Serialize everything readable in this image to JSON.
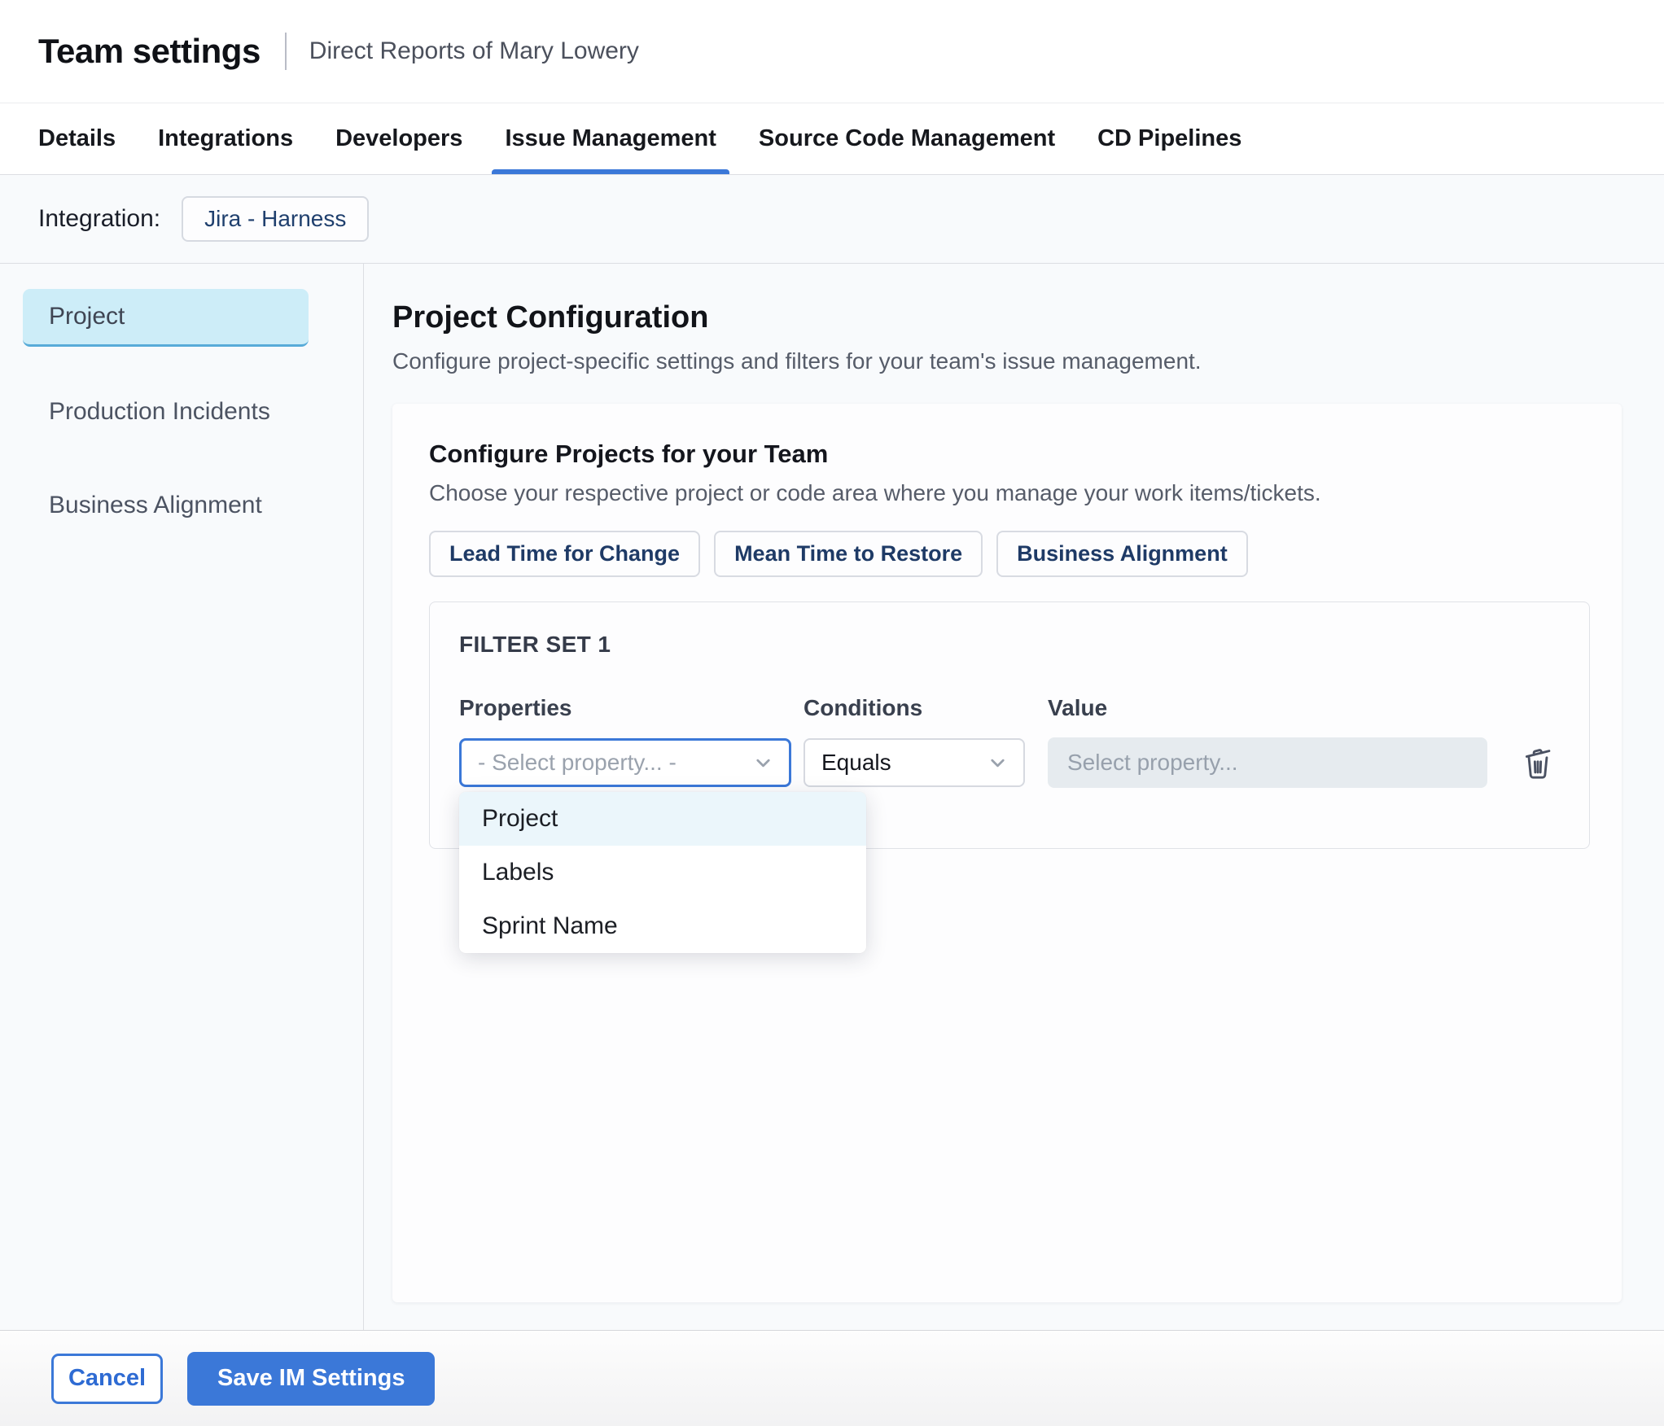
{
  "page": {
    "title": "Team settings",
    "subtitle": "Direct Reports of Mary Lowery"
  },
  "tabs": [
    {
      "label": "Details",
      "active": false
    },
    {
      "label": "Integrations",
      "active": false
    },
    {
      "label": "Developers",
      "active": false
    },
    {
      "label": "Issue Management",
      "active": true
    },
    {
      "label": "Source Code Management",
      "active": false
    },
    {
      "label": "CD Pipelines",
      "active": false
    }
  ],
  "integration": {
    "label": "Integration:",
    "chip": "Jira - Harness"
  },
  "sidebar": {
    "items": [
      {
        "label": "Project",
        "selected": true
      },
      {
        "label": "Production Incidents",
        "selected": false
      },
      {
        "label": "Business Alignment",
        "selected": false
      }
    ]
  },
  "main": {
    "heading": "Project Configuration",
    "description": "Configure project-specific settings and filters for your team's issue management.",
    "card": {
      "title": "Configure Projects for your Team",
      "subtitle": "Choose your respective project or code area where you manage your work items/tickets.",
      "chips": [
        "Lead Time for Change",
        "Mean Time to Restore",
        "Business Alignment"
      ],
      "filter_set": {
        "title": "FILTER SET 1",
        "columns": [
          "Properties",
          "Conditions",
          "Value"
        ],
        "property_select": {
          "placeholder": "- Select property... -"
        },
        "condition_select": {
          "value": "Equals"
        },
        "value_input": {
          "placeholder": "Select property..."
        },
        "dropdown_options": [
          {
            "label": "Project",
            "highlighted": true
          },
          {
            "label": "Labels",
            "highlighted": false
          },
          {
            "label": "Sprint Name",
            "highlighted": false
          }
        ]
      }
    }
  },
  "footer": {
    "cancel_label": "Cancel",
    "save_label": "Save IM Settings"
  },
  "colors": {
    "accent_blue": "#3b78d8",
    "sidebar_selected_bg": "#cdedf8",
    "sidebar_selected_border": "#58abd8",
    "menu_highlight": "#ebf6fb",
    "disabled_input_bg": "#e6ebef",
    "chip_text": "#1e3a66",
    "page_bg": "#f8fafc"
  }
}
